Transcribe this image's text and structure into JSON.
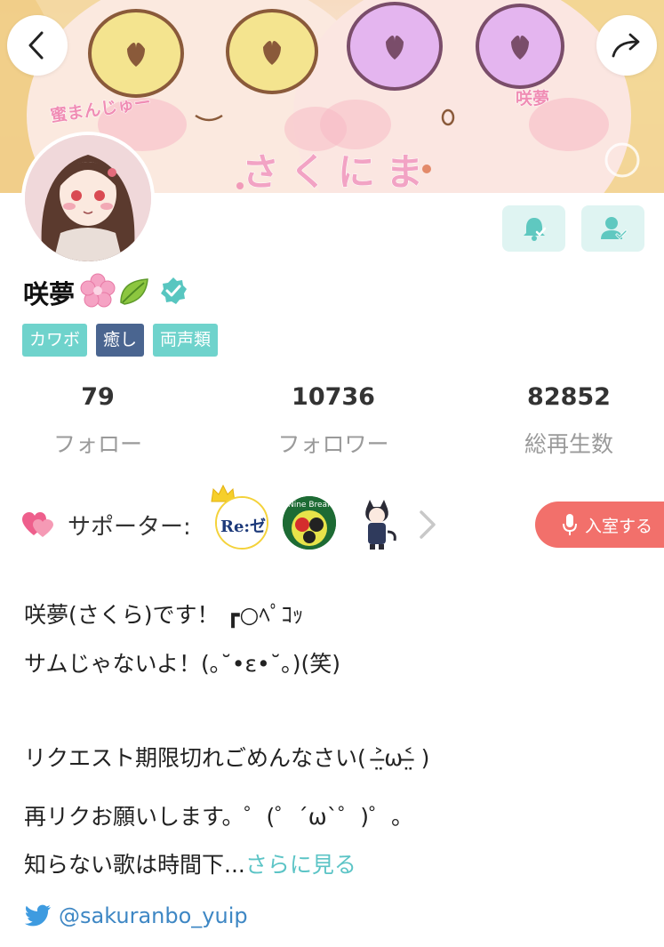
{
  "banner": {
    "title": "さくにま",
    "left_name": "蜜まんじゅー",
    "right_name": "咲夢"
  },
  "profile": {
    "name": "咲夢",
    "emoji_flower": "🌸",
    "emoji_leaf": "🍃",
    "verified": true,
    "tags": [
      {
        "label": "カワボ",
        "color": "#6fd3cc"
      },
      {
        "label": "癒し",
        "color": "#4a6590"
      },
      {
        "label": "両声類",
        "color": "#6fd3cc"
      }
    ]
  },
  "stats": [
    {
      "value": "79",
      "label": "フォロー"
    },
    {
      "value": "10736",
      "label": "フォロワー"
    },
    {
      "value": "82852",
      "label": "総再生数"
    }
  ],
  "supporters": {
    "label": "サポーター:",
    "avatar_1_text": "Re:ゼロ",
    "avatar_2_text": "Nine Break",
    "enter_button": "入室する"
  },
  "bio": {
    "line1": "咲夢(さくら)です！ ┏○ﾍﾟｺｯ",
    "line2": "サムじゃないよ！(｡˘•ε•˘｡)(笑)",
    "line3": "リクエスト期限切れごめんなさい( ˃̶̤ω˂̶̤ )",
    "line4": "再リクお願いします。゜(゜´ω`゜)゜。",
    "line5": "知らない歌は時間下...",
    "more_link": "さらに見る"
  },
  "twitter": {
    "handle": "@sakuranbo_yuip"
  },
  "colors": {
    "accent_teal": "#6fd3cc",
    "tag_navy": "#4a6590",
    "enter_red": "#f2706b",
    "twitter_blue": "#3e87c4",
    "link_teal": "#5cc4c6"
  }
}
